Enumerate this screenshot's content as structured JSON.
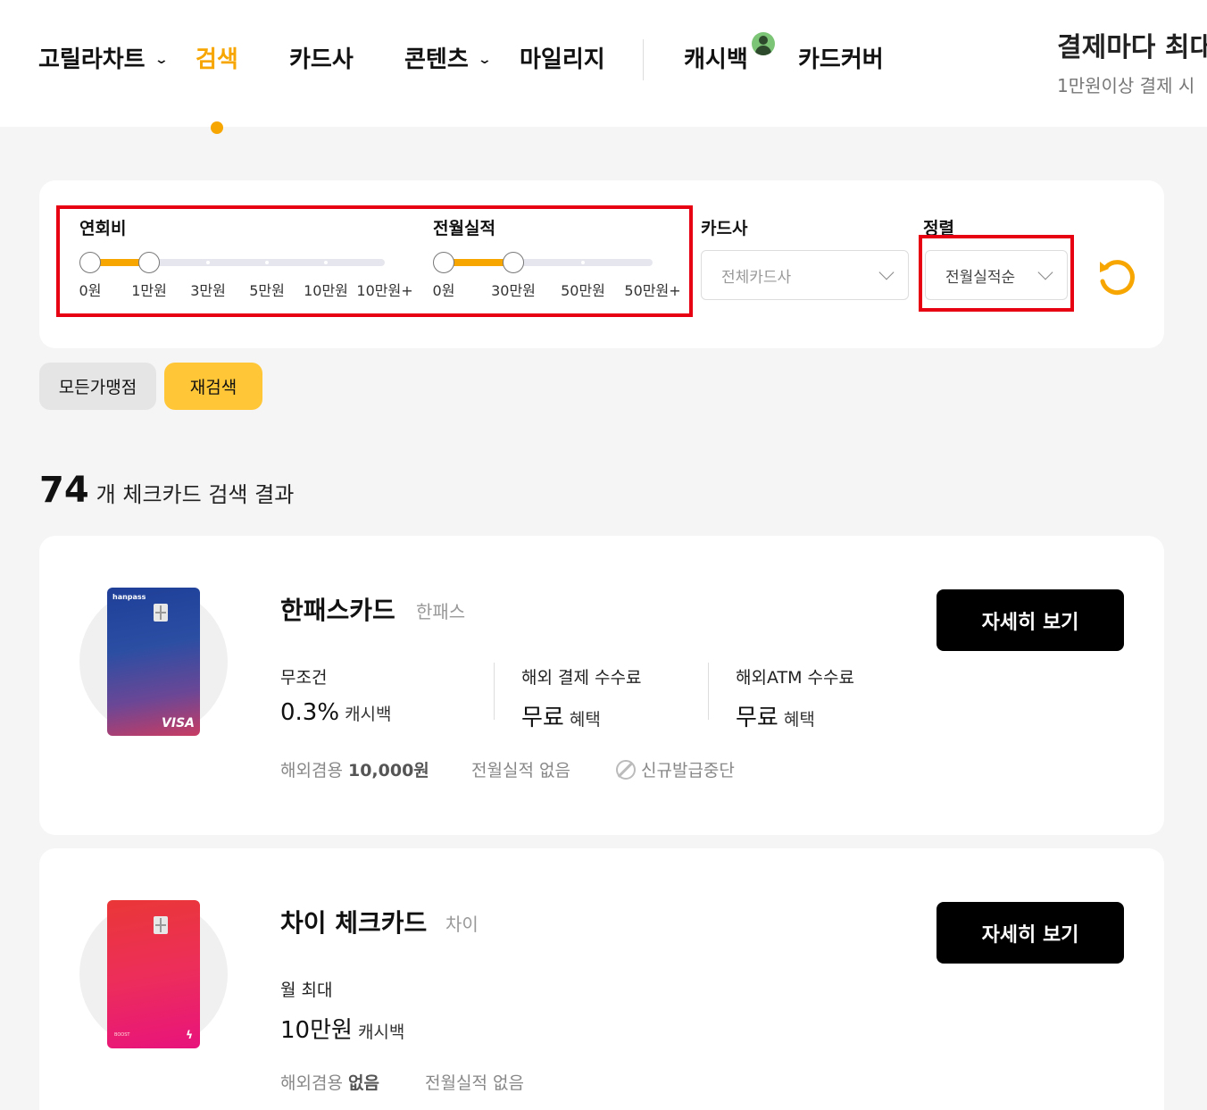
{
  "nav": {
    "items": [
      {
        "label": "고릴라차트",
        "dropdown": true
      },
      {
        "label": "검색",
        "active": true
      },
      {
        "label": "카드사"
      },
      {
        "label": "콘텐츠",
        "dropdown": true
      },
      {
        "label": "마일리지"
      },
      {
        "label": "캐시백",
        "badge": "avatar"
      },
      {
        "label": "카드커버"
      }
    ],
    "promo_title": "결제마다 최대",
    "promo_sub": "1만원이상 결제 시"
  },
  "filters": {
    "annual_fee": {
      "label": "연회비",
      "ticks": [
        "0원",
        "1만원",
        "3만원",
        "5만원",
        "10만원",
        "10만원+"
      ],
      "selected_range": [
        0,
        1
      ]
    },
    "prev_month": {
      "label": "전월실적",
      "ticks": [
        "0원",
        "30만원",
        "50만원",
        "50만원+"
      ],
      "selected_range": [
        0,
        1
      ]
    },
    "card_company": {
      "label": "카드사",
      "placeholder": "전체카드사"
    },
    "sort": {
      "label": "정렬",
      "value": "전월실적순"
    },
    "reset_icon": "reset-icon",
    "highlight_color": "#e60012",
    "accent_color": "#f7a600"
  },
  "chips": {
    "all_merchants": "모든가맹점",
    "research": "재검색"
  },
  "results": {
    "count": "74",
    "text": "개 체크카드 검색 결과"
  },
  "cards": [
    {
      "name": "한패스카드",
      "issuer": "한패스",
      "brand_text": "hanpass",
      "network": "VISA",
      "benefits": [
        {
          "label": "무조건",
          "value": "0.3%",
          "unit": "캐시백"
        },
        {
          "label": "해외 결제 수수료",
          "value": "무료",
          "unit": "혜택"
        },
        {
          "label": "해외ATM 수수료",
          "value": "무료",
          "unit": "혜택"
        }
      ],
      "annual_fee_label": "해외겸용",
      "annual_fee_value": "10,000원",
      "prev_month": "전월실적 없음",
      "status": "신규발급중단",
      "detail_button": "자세히 보기"
    },
    {
      "name": "차이 체크카드",
      "issuer": "차이",
      "tiny_text": "BOOST",
      "benefits": [
        {
          "label": "월 최대",
          "value": "10만원",
          "unit": "캐시백"
        }
      ],
      "annual_fee_label": "해외겸용",
      "annual_fee_value": "없음",
      "prev_month": "전월실적 없음",
      "detail_button": "자세히 보기"
    }
  ]
}
